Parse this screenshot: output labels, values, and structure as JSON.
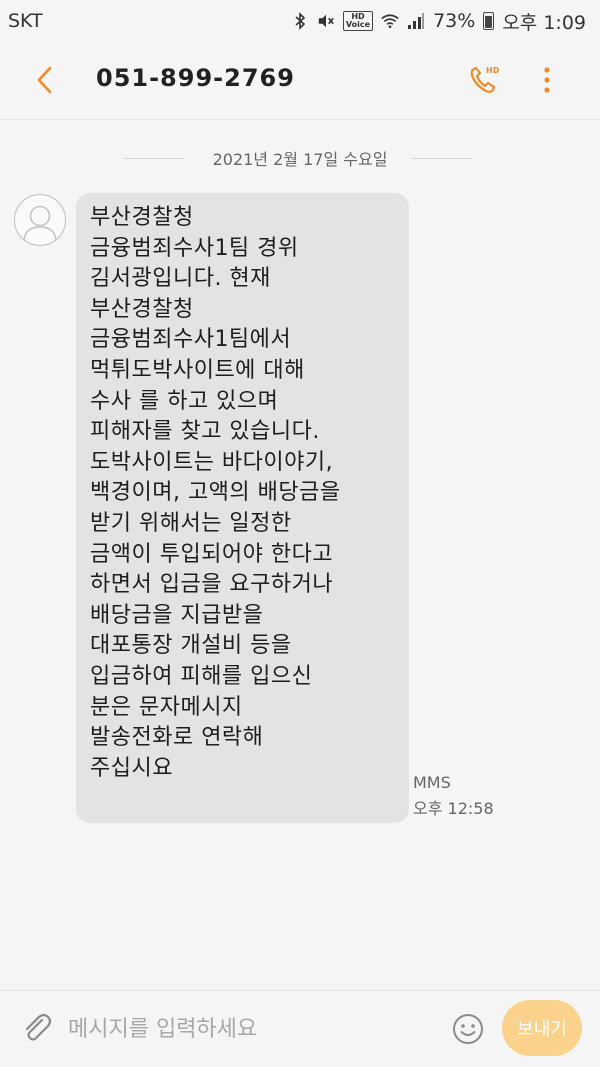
{
  "status_bar": {
    "carrier": "SKT",
    "battery_percent": "73%",
    "time": "오후 1:09",
    "battery_level": 0.73,
    "icons": [
      "bluetooth-icon",
      "mute-icon",
      "hd-voice-icon",
      "wifi-icon",
      "signal-icon",
      "battery-icon"
    ]
  },
  "header": {
    "title": "051-899-2769",
    "accent_color": "#f08a2c"
  },
  "conversation": {
    "date": "2021년 2월 17일 수요일",
    "messages": [
      {
        "text": "부산경찰청\n금융범죄수사1팀 경위\n김서광입니다. 현재\n부산경찰청\n금융범죄수사1팀에서\n먹튀도박사이트에 대해\n수사 를 하고 있으며\n피해자를 찾고 있습니다.\n도박사이트는 바다이야기,\n백경이며, 고액의 배당금을\n받기 위해서는 일정한\n금액이 투입되어야 한다고\n하면서 입금을 요구하거나\n배당금을 지급받을\n대포통장 개설비 등을\n입금하여 피해를 입으신\n분은 문자메시지\n발송전화로 연락해\n주십시요",
        "type": "MMS",
        "time": "오후 12:58"
      }
    ]
  },
  "input_bar": {
    "placeholder": "메시지를 입력하세요",
    "send_label": "보내기"
  }
}
